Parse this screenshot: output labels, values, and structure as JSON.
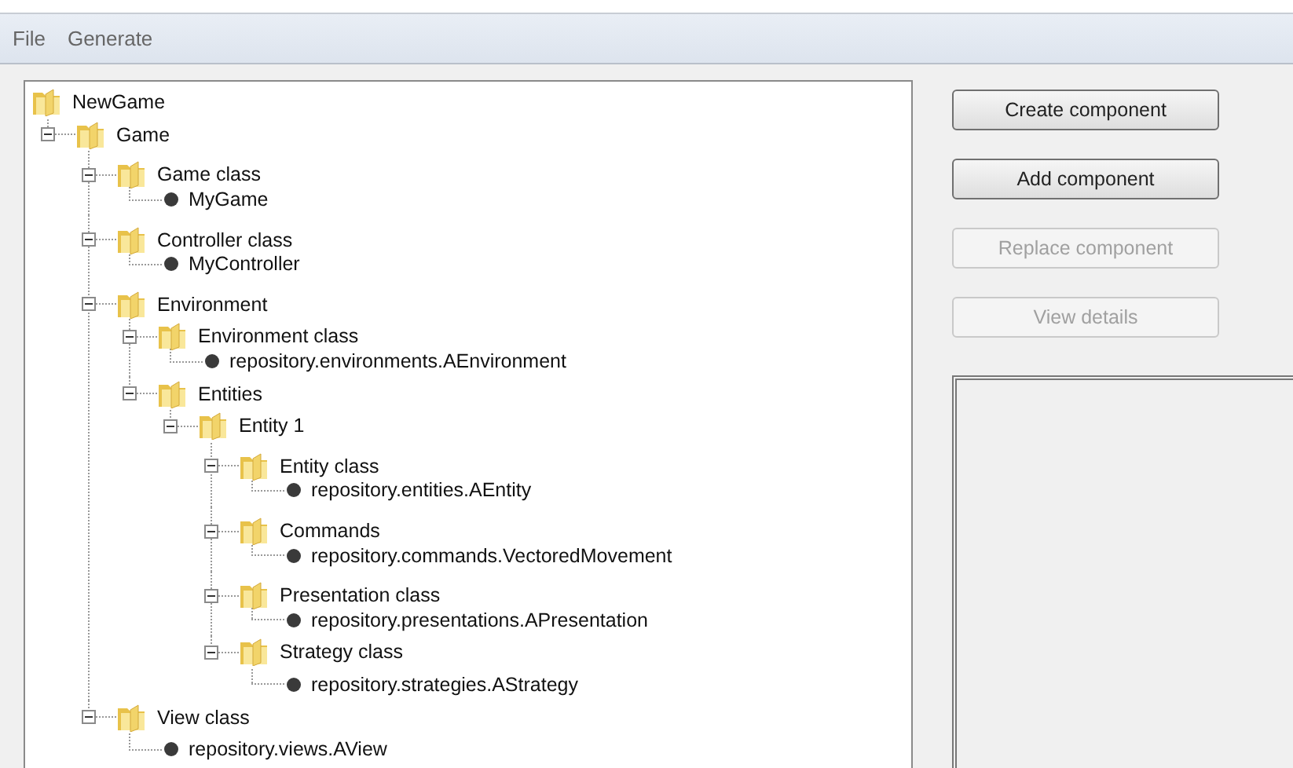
{
  "menu": [
    {
      "label": "File"
    },
    {
      "label": "Generate"
    }
  ],
  "tree": {
    "root": {
      "label": "NewGame",
      "children": [
        {
          "kind": "folder",
          "label": "Game",
          "expanded": true,
          "children": [
            {
              "kind": "folder",
              "label": "Game class",
              "expanded": true,
              "children": [
                {
                  "kind": "leaf",
                  "label": "MyGame"
                }
              ]
            },
            {
              "kind": "folder",
              "label": "Controller class",
              "expanded": true,
              "children": [
                {
                  "kind": "leaf",
                  "label": "MyController"
                }
              ]
            },
            {
              "kind": "folder",
              "label": "Environment",
              "expanded": true,
              "children": [
                {
                  "kind": "folder",
                  "label": "Environment class",
                  "expanded": true,
                  "children": [
                    {
                      "kind": "leaf",
                      "label": "repository.environments.AEnvironment"
                    }
                  ]
                },
                {
                  "kind": "folder",
                  "label": "Entities",
                  "expanded": true,
                  "children": [
                    {
                      "kind": "folder",
                      "label": "Entity 1",
                      "expanded": true,
                      "children": [
                        {
                          "kind": "folder",
                          "label": "Entity class",
                          "expanded": true,
                          "children": [
                            {
                              "kind": "leaf",
                              "label": "repository.entities.AEntity"
                            }
                          ]
                        },
                        {
                          "kind": "folder",
                          "label": "Commands",
                          "expanded": true,
                          "children": [
                            {
                              "kind": "leaf",
                              "label": "repository.commands.VectoredMovement"
                            }
                          ]
                        },
                        {
                          "kind": "folder",
                          "label": "Presentation class",
                          "expanded": true,
                          "children": [
                            {
                              "kind": "leaf",
                              "label": "repository.presentations.APresentation"
                            }
                          ]
                        },
                        {
                          "kind": "folder",
                          "label": "Strategy class",
                          "expanded": true,
                          "children": [
                            {
                              "kind": "leaf",
                              "label": "repository.strategies.AStrategy"
                            }
                          ]
                        }
                      ]
                    }
                  ]
                }
              ]
            },
            {
              "kind": "folder",
              "label": "View class",
              "expanded": true,
              "children": [
                {
                  "kind": "leaf",
                  "label": "repository.views.AView"
                }
              ]
            }
          ]
        }
      ]
    }
  },
  "buttons": [
    {
      "label": "Create component",
      "disabled": false
    },
    {
      "label": "Add component",
      "disabled": false
    },
    {
      "label": "Replace component",
      "disabled": true
    },
    {
      "label": "View details",
      "disabled": true
    }
  ]
}
